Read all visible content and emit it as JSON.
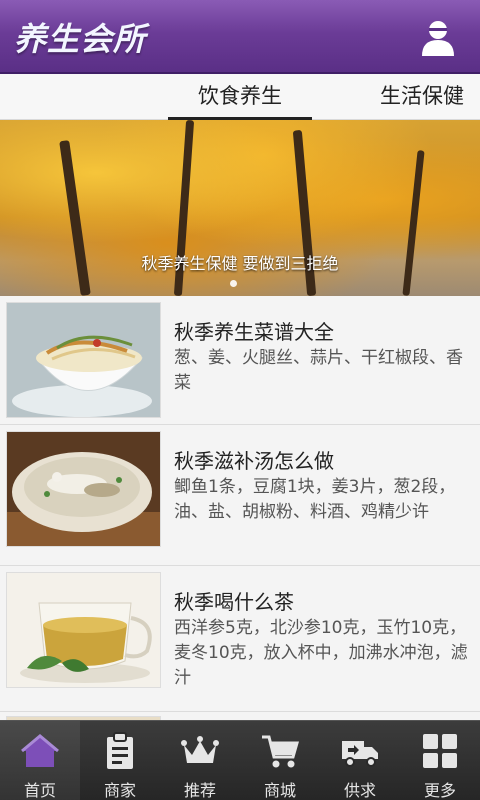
{
  "header": {
    "title": "养生会所",
    "user_icon": "user-icon"
  },
  "tabs": [
    {
      "label": "饮食养生",
      "active": true
    },
    {
      "label": "生活保健",
      "active": false
    }
  ],
  "banner": {
    "caption": "秋季养生保健 要做到三拒绝",
    "page_count": 1,
    "current_page": 1
  },
  "articles": [
    {
      "title": "秋季养生菜谱大全",
      "desc": "葱、姜、火腿丝、蒜片、干红椒段、香菜",
      "image": "noodle-bowl-image"
    },
    {
      "title": "秋季滋补汤怎么做",
      "desc": "鲫鱼1条，豆腐1块，姜3片，葱2段，油、盐、胡椒粉、料酒、鸡精少许",
      "image": "fish-soup-image"
    },
    {
      "title": "秋季喝什么茶",
      "desc": "西洋参5克，北沙参10克，玉竹10克，麦冬10克，放入杯中，加沸水冲泡，滤汁",
      "image": "tea-cup-image"
    }
  ],
  "bottom_nav": [
    {
      "label": "首页",
      "icon": "home-icon",
      "active": true
    },
    {
      "label": "商家",
      "icon": "merchant-icon",
      "active": false
    },
    {
      "label": "推荐",
      "icon": "crown-icon",
      "active": false
    },
    {
      "label": "商城",
      "icon": "cart-icon",
      "active": false
    },
    {
      "label": "供求",
      "icon": "truck-icon",
      "active": false
    },
    {
      "label": "更多",
      "icon": "grid-icon",
      "active": false
    }
  ],
  "colors": {
    "header_purple": "#6b3c97",
    "nav_dark": "#2e2e2e",
    "active_icon": "#7d4fb8"
  }
}
